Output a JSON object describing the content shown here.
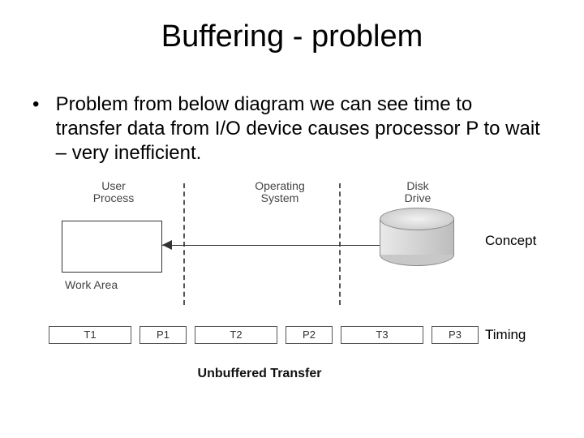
{
  "title": "Buffering - problem",
  "bullet": "Problem from below diagram we can see time to transfer data from I/O device causes processor P to wait – very inefficient.",
  "diagram": {
    "user_process": "User\nProcess",
    "os": "Operating\nSystem",
    "disk": "Disk\nDrive",
    "work_area": "Work Area",
    "concept": "Concept",
    "timing_label": "Timing",
    "timing": {
      "t1": "T1",
      "p1": "P1",
      "t2": "T2",
      "p2": "P2",
      "t3": "T3",
      "p3": "P3"
    },
    "caption": "Unbuffered Transfer"
  }
}
